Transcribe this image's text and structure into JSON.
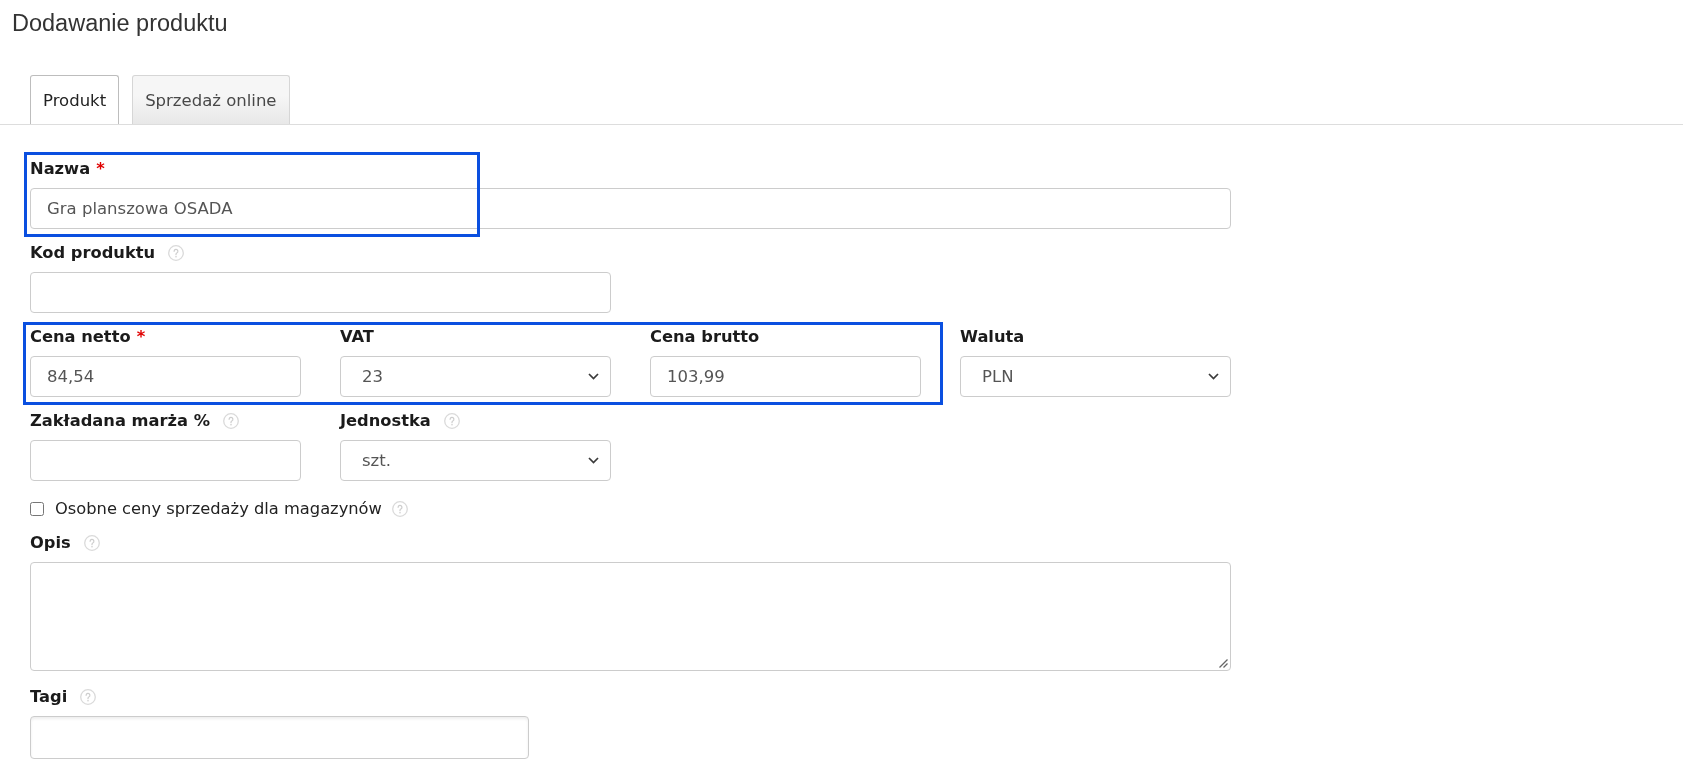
{
  "page": {
    "title": "Dodawanie produktu"
  },
  "tabs": [
    {
      "label": "Produkt",
      "selected": true
    },
    {
      "label": "Sprzedaż online",
      "selected": false
    }
  ],
  "form": {
    "rows": [
      {
        "fields": [
          {
            "kind": "text",
            "label": "Nazwa",
            "required_mark": "*",
            "help": false,
            "value": "Gra planszowa OSADA",
            "highlighted": true
          }
        ]
      },
      {
        "fields": [
          {
            "kind": "text",
            "label": "Kod produktu",
            "help": true,
            "highlighted": false
          }
        ]
      },
      {
        "fields": [
          {
            "kind": "text",
            "label": "Cena netto",
            "required_mark": "*",
            "help": false,
            "value": "84,54",
            "highlighted": true
          },
          {
            "kind": "select",
            "label": "VAT",
            "help": false,
            "value": "23",
            "highlighted": true
          },
          {
            "kind": "text",
            "label": "Cena brutto",
            "help": false,
            "value": "103,99",
            "highlighted": true
          },
          {
            "kind": "select",
            "label": "Waluta",
            "help": false,
            "value": "PLN",
            "highlighted": false
          }
        ]
      },
      {
        "fields": [
          {
            "kind": "text",
            "label": "Zakładana marża %",
            "help": true,
            "highlighted": false
          },
          {
            "kind": "select",
            "label": "Jednostka",
            "help": true,
            "value": "szt.",
            "highlighted": false
          }
        ]
      },
      {
        "fields": [
          {
            "kind": "checkbox",
            "label": "Osobne ceny sprzedaży dla magazynów",
            "checked": false,
            "help": true,
            "highlighted": false
          }
        ]
      },
      {
        "fields": [
          {
            "kind": "textarea",
            "label": "Opis",
            "help": true,
            "highlighted": false
          }
        ]
      },
      {
        "fields": [
          {
            "kind": "tags",
            "label": "Tagi",
            "help": true,
            "highlighted": false
          }
        ]
      }
    ]
  }
}
